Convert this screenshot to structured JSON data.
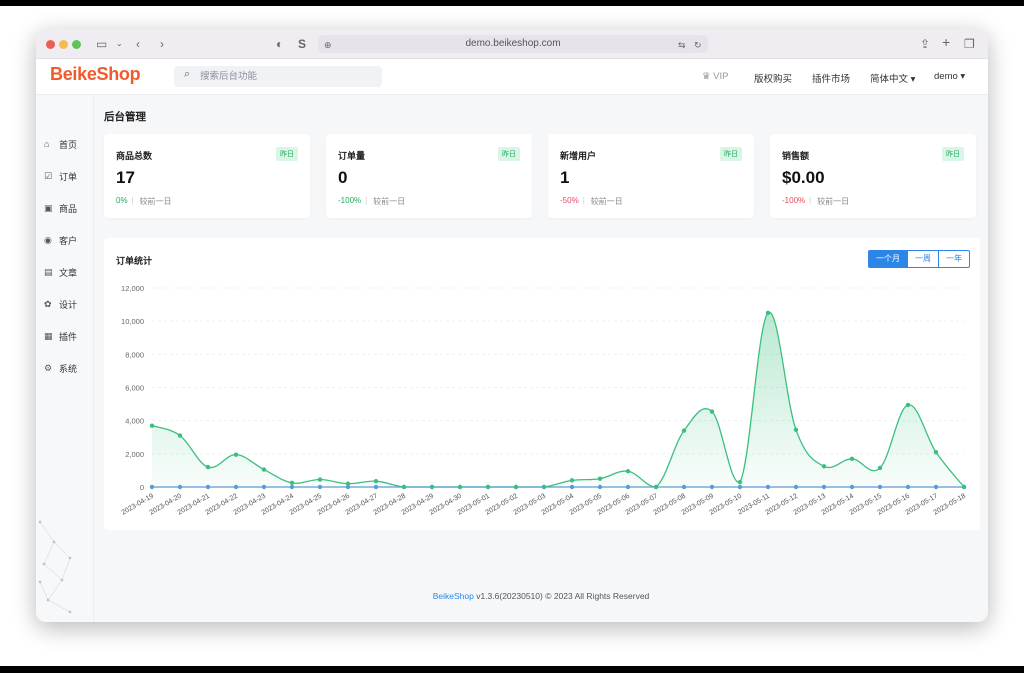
{
  "browser": {
    "url": "demo.beikeshop.com",
    "traffic_colors": [
      "#ec5f58",
      "#f5bd4f",
      "#5fc454"
    ]
  },
  "header": {
    "logo": "BeikeShop",
    "search_placeholder": "搜索后台功能",
    "vip": "VIP",
    "license": "版权购买",
    "plugin_market": "插件市场",
    "language": "简体中文 ▾",
    "user": "demo ▾"
  },
  "sidebar": {
    "items": [
      {
        "label": "首页",
        "icon": "home-icon"
      },
      {
        "label": "订单",
        "icon": "order-icon"
      },
      {
        "label": "商品",
        "icon": "box-icon"
      },
      {
        "label": "客户",
        "icon": "user-icon"
      },
      {
        "label": "文章",
        "icon": "document-icon"
      },
      {
        "label": "设计",
        "icon": "palette-icon"
      },
      {
        "label": "插件",
        "icon": "plugin-icon"
      },
      {
        "label": "系统",
        "icon": "settings-icon"
      }
    ]
  },
  "page_title": "后台管理",
  "stats": [
    {
      "label": "商品总数",
      "badge": "昨日",
      "value": "17",
      "change": "0%",
      "change_color": "#1faa5c",
      "compare": "较前一日"
    },
    {
      "label": "订单量",
      "badge": "昨日",
      "value": "0",
      "change": "-100%",
      "change_color": "#1faa5c",
      "compare": "较前一日"
    },
    {
      "label": "新增用户",
      "badge": "昨日",
      "value": "1",
      "change": "-50%",
      "change_color": "#e84a5f",
      "compare": "较前一日"
    },
    {
      "label": "销售额",
      "badge": "昨日",
      "value": "$0.00",
      "change": "-100%",
      "change_color": "#e84a5f",
      "compare": "较前一日"
    }
  ],
  "chart_section": {
    "title": "订单统计",
    "ranges": [
      "一个月",
      "一周",
      "一年"
    ],
    "active_range": "一个月"
  },
  "chart_data": {
    "type": "line",
    "categories": [
      "2023-04-19",
      "2023-04-20",
      "2023-04-21",
      "2023-04-22",
      "2023-04-23",
      "2023-04-24",
      "2023-04-25",
      "2023-04-26",
      "2023-04-27",
      "2023-04-28",
      "2023-04-29",
      "2023-04-30",
      "2023-05-01",
      "2023-05-02",
      "2023-05-03",
      "2023-05-04",
      "2023-05-05",
      "2023-05-06",
      "2023-05-07",
      "2023-05-08",
      "2023-05-09",
      "2023-05-10",
      "2023-05-11",
      "2023-05-12",
      "2023-05-13",
      "2023-05-14",
      "2023-05-15",
      "2023-05-16",
      "2023-05-17",
      "2023-05-18"
    ],
    "series": [
      {
        "color": "#3bbf7f",
        "values": [
          3700,
          3100,
          1200,
          1950,
          1050,
          250,
          450,
          200,
          350,
          0,
          0,
          0,
          0,
          0,
          0,
          400,
          500,
          950,
          0,
          3400,
          4550,
          300,
          10500,
          3450,
          1250,
          1700,
          1150,
          4950,
          2100,
          0
        ]
      },
      {
        "color": "#5b9bd5",
        "values": [
          0,
          0,
          0,
          0,
          0,
          0,
          0,
          0,
          0,
          0,
          0,
          0,
          0,
          0,
          0,
          0,
          0,
          0,
          0,
          0,
          0,
          0,
          0,
          0,
          0,
          0,
          0,
          0,
          0,
          0
        ]
      }
    ],
    "ylim": [
      0,
      12000
    ],
    "yticks": [
      "0",
      "2,000",
      "4,000",
      "6,000",
      "8,000",
      "10,000",
      "12,000"
    ],
    "grid": true
  },
  "footer": {
    "brand": "BeikeShop",
    "text": " v1.3.6(20230510) © 2023 All Rights Reserved"
  }
}
